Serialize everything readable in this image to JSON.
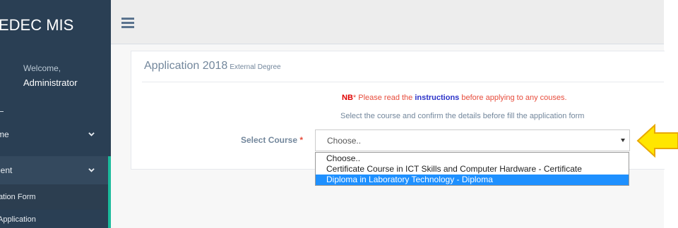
{
  "app": {
    "brand": "EDEC MIS"
  },
  "sidebar": {
    "welcome": "Welcome,",
    "user_name": "Administrator",
    "items": [
      {
        "label": "me"
      },
      {
        "label": "dent"
      }
    ],
    "sub_items": [
      {
        "label": "ication Form"
      },
      {
        "label": "Application"
      }
    ]
  },
  "panel": {
    "title": "Application 2018",
    "subtitle": "External Degree",
    "nb_prefix": "NB",
    "nb_text_1": "* Please read the ",
    "nb_link": "instructions",
    "nb_text_2": " before applying to any couses.",
    "hint": "Select the course and confirm the details before fill the application form",
    "course_label": "Select Course",
    "required_mark": "*"
  },
  "course_select": {
    "selected": "Choose..",
    "options": [
      "Choose..",
      "Certificate Course in ICT Skills and Computer Hardware - Certificate",
      "Diploma in Laboratory Technology - Diploma"
    ],
    "highlighted_index": 2
  },
  "colors": {
    "sidebar": "#2a3f54",
    "accent": "#1abb9c",
    "highlight": "#1e90ff",
    "arrow_fill": "#ffe600",
    "arrow_stroke": "#e8a800"
  },
  "icons": {
    "menu": "hamburger-icon",
    "chevron": "chevron-down-icon",
    "select_arrow": "caret-down-icon",
    "pointer": "arrow-left-icon"
  }
}
